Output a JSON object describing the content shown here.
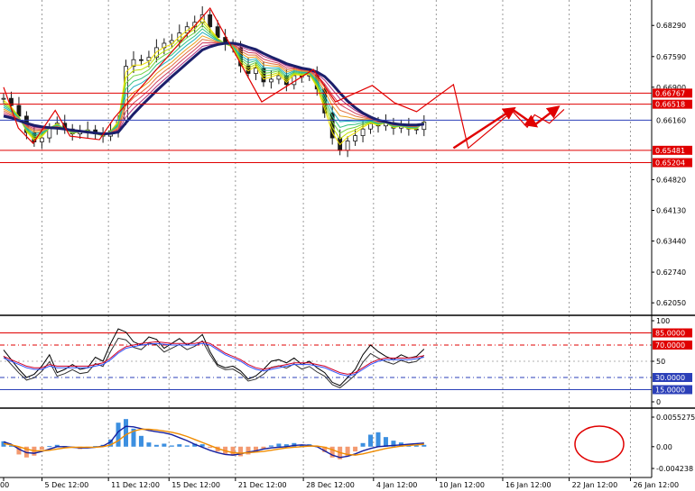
{
  "chart_data": {
    "type": "line",
    "main": {
      "type": "candlestick",
      "ylim": [
        0.6185,
        0.687
      ],
      "price_ticks": [
        "0.68290",
        "0.67590",
        "0.66900",
        "0.64820",
        "0.64130",
        "0.63440",
        "0.62740",
        "0.62050"
      ],
      "levels": [
        {
          "label": "0.66767",
          "value": 0.66767,
          "color": "#e00000"
        },
        {
          "label": "0.66518",
          "value": 0.66518,
          "color": "#e00000"
        },
        {
          "label": "0.66160",
          "value": 0.6616,
          "color": "#2b3fb8"
        },
        {
          "label": "0.65481",
          "value": 0.65481,
          "color": "#e00000"
        },
        {
          "label": "0.65204",
          "value": 0.65204,
          "color": "#e00000"
        }
      ],
      "close": [
        0.6665,
        0.6649,
        0.6625,
        0.6588,
        0.6567,
        0.6576,
        0.6598,
        0.6609,
        0.6596,
        0.6585,
        0.659,
        0.6594,
        0.6585,
        0.658,
        0.6592,
        0.6616,
        0.6737,
        0.6752,
        0.675,
        0.6757,
        0.6779,
        0.6789,
        0.6795,
        0.6812,
        0.6826,
        0.6836,
        0.6853,
        0.6826,
        0.6802,
        0.6787,
        0.6779,
        0.6738,
        0.6721,
        0.6733,
        0.6702,
        0.6708,
        0.6716,
        0.6696,
        0.6716,
        0.6715,
        0.6718,
        0.6686,
        0.6632,
        0.6576,
        0.6548,
        0.6569,
        0.6581,
        0.6596,
        0.6608,
        0.6603,
        0.661,
        0.6598,
        0.6602,
        0.6596,
        0.6595,
        0.6612
      ],
      "ma_slow": [
        0.6625,
        0.6621,
        0.6615,
        0.6609,
        0.6604,
        0.6601,
        0.6599,
        0.6598,
        0.6596,
        0.6593,
        0.6591,
        0.6589,
        0.6587,
        0.6585,
        0.6586,
        0.6589,
        0.661,
        0.663,
        0.6648,
        0.6665,
        0.6682,
        0.6698,
        0.6714,
        0.6729,
        0.6744,
        0.6759,
        0.6774,
        0.6781,
        0.6786,
        0.6789,
        0.6789,
        0.6786,
        0.678,
        0.6775,
        0.6766,
        0.6758,
        0.6751,
        0.6743,
        0.6738,
        0.6733,
        0.673,
        0.6724,
        0.6714,
        0.6697,
        0.6677,
        0.6659,
        0.6644,
        0.6632,
        0.6623,
        0.6616,
        0.6612,
        0.6608,
        0.6606,
        0.6605,
        0.6605,
        0.6607
      ],
      "zigzag": [
        [
          0,
          0.669
        ],
        [
          2,
          0.6598
        ],
        [
          4,
          0.6564
        ],
        [
          7,
          0.6638
        ],
        [
          9,
          0.658
        ],
        [
          13,
          0.6572
        ],
        [
          15,
          0.6621
        ],
        [
          28,
          0.6868
        ],
        [
          35,
          0.6657
        ],
        [
          42,
          0.673
        ],
        [
          45,
          0.6657
        ],
        [
          50,
          0.6694
        ],
        [
          53,
          0.6655
        ],
        [
          56,
          0.6635
        ],
        [
          61,
          0.6696
        ],
        [
          63,
          0.6553
        ],
        [
          69,
          0.6636
        ],
        [
          71,
          0.66
        ],
        [
          72,
          0.6628
        ],
        [
          74,
          0.6609
        ],
        [
          76,
          0.664
        ]
      ],
      "arrows": [
        [
          [
            61,
            0.6553
          ],
          [
            69,
            0.664
          ]
        ],
        [
          [
            69,
            0.664
          ],
          [
            72,
            0.6605
          ]
        ],
        [
          [
            72,
            0.6605
          ],
          [
            75,
            0.6643
          ]
        ]
      ]
    },
    "oscillator": {
      "ylim": [
        0,
        100
      ],
      "ticks": [
        "100",
        "50",
        "0"
      ],
      "levels": [
        {
          "label": "85.0000",
          "value": 85,
          "color": "#e00000"
        },
        {
          "label": "70.0000",
          "value": 70,
          "color": "#e00000"
        },
        {
          "label": "30.0000",
          "value": 30,
          "color": "#2b3fb8"
        },
        {
          "label": "15.0000",
          "value": 15,
          "color": "#2b3fb8"
        }
      ],
      "main": [
        64,
        52,
        40,
        30,
        34,
        44,
        58,
        36,
        40,
        46,
        40,
        42,
        55,
        50,
        72,
        90,
        86,
        74,
        70,
        80,
        77,
        66,
        72,
        78,
        70,
        75,
        83,
        62,
        46,
        42,
        44,
        38,
        28,
        32,
        40,
        50,
        52,
        48,
        54,
        46,
        50,
        42,
        36,
        24,
        20,
        30,
        40,
        58,
        70,
        62,
        56,
        52,
        58,
        54,
        56,
        65
      ],
      "signal": [
        56,
        52,
        48,
        44,
        42,
        42,
        46,
        44,
        44,
        44,
        44,
        44,
        46,
        48,
        54,
        62,
        68,
        70,
        72,
        73,
        74,
        73,
        72,
        72,
        72,
        72,
        74,
        72,
        66,
        60,
        56,
        52,
        46,
        42,
        40,
        42,
        44,
        46,
        48,
        48,
        48,
        46,
        44,
        40,
        36,
        34,
        36,
        42,
        48,
        52,
        54,
        54,
        54,
        54,
        55,
        57
      ]
    },
    "macd": {
      "ylim": [
        -0.004238,
        0.0055275
      ],
      "ticks": [
        "0.0055275",
        "0.00",
        "-0.004238"
      ],
      "histogram": [
        0.0009,
        0.0002,
        -0.0013,
        -0.0018,
        -0.0015,
        -0.0005,
        0.0001,
        0.0003,
        0.0001,
        -0.0002,
        -0.0004,
        -0.0002,
        0.0001,
        0.0003,
        0.0012,
        0.004,
        0.0046,
        0.003,
        0.0018,
        0.0007,
        0.0003,
        0.0005,
        0.0002,
        0.0004,
        0.0002,
        0.0005,
        0.0004,
        -0.0002,
        -0.0008,
        -0.0012,
        -0.0015,
        -0.0016,
        -0.0013,
        -0.0008,
        -0.0004,
        0.0002,
        0.0005,
        0.0004,
        0.0006,
        0.0003,
        0.0004,
        0.0001,
        -0.0009,
        -0.0018,
        -0.0021,
        -0.0016,
        -0.0008,
        0.0006,
        0.002,
        0.0024,
        0.0016,
        0.001,
        0.0007,
        0.0004,
        0.0002,
        0.0003
      ],
      "macd_line": [
        0.0008,
        0.0004,
        -0.0004,
        -0.001,
        -0.0011,
        -0.0008,
        -0.0004,
        0.0,
        0.0,
        -0.0001,
        -0.0002,
        -0.0002,
        -0.0001,
        0.0001,
        0.0008,
        0.0025,
        0.0034,
        0.0033,
        0.003,
        0.0027,
        0.0025,
        0.0023,
        0.002,
        0.0015,
        0.001,
        0.0004,
        -0.0001,
        -0.0006,
        -0.001,
        -0.0013,
        -0.0014,
        -0.0012,
        -0.0009,
        -0.0007,
        -0.0004,
        -0.0002,
        -0.0001,
        0.0,
        0.0002,
        0.0003,
        0.0002,
        0.0,
        -0.0007,
        -0.0014,
        -0.0018,
        -0.0016,
        -0.0012,
        -0.0007,
        -0.0003,
        0.0,
        0.0001,
        0.0002,
        0.0003,
        0.0004,
        0.0005,
        0.0006
      ],
      "signal_line": [
        0.0005,
        0.0003,
        0.0,
        -0.0004,
        -0.0007,
        -0.0007,
        -0.0006,
        -0.0004,
        -0.0002,
        -0.0001,
        -0.0001,
        -0.0001,
        -0.0001,
        0.0,
        0.0003,
        0.001,
        0.002,
        0.0026,
        0.0029,
        0.0029,
        0.0028,
        0.0026,
        0.0024,
        0.0021,
        0.0017,
        0.0012,
        0.0007,
        0.0002,
        -0.0003,
        -0.0007,
        -0.001,
        -0.0011,
        -0.001,
        -0.0009,
        -0.0008,
        -0.0006,
        -0.0004,
        -0.0002,
        -0.0001,
        0.0,
        0.0001,
        0.0001,
        -0.0001,
        -0.0005,
        -0.001,
        -0.0013,
        -0.0014,
        -0.0012,
        -0.0009,
        -0.0006,
        -0.0003,
        -0.0001,
        0.0001,
        0.0002,
        0.0003,
        0.0004
      ]
    },
    "x_labels": [
      "00",
      "5 Dec 12:00",
      "11 Dec 12:00",
      "15 Dec 12:00",
      "21 Dec 12:00",
      "28 Dec 12:00",
      "4 Jan 12:00",
      "10 Jan 12:00",
      "16 Jan 12:00",
      "22 Jan 12:00",
      "26 Jan 12:00"
    ],
    "x_label_index": [
      0,
      5.2,
      14.2,
      22.4,
      31.4,
      40.6,
      50.1,
      58.6,
      67.6,
      76.6,
      84.9
    ],
    "colors": {
      "bull": "#1a1a1a",
      "bear": "#1a1a1a",
      "ma_slow": "#1b1f6b",
      "zigzag": "#e00000",
      "arrow": "#e00000",
      "osc_main": "#000000",
      "osc_signal": "#d0002a",
      "osc_third": "#3050ff",
      "hist_pos": "#3c8fe0",
      "hist_neg": "#f39a70",
      "macd_line": "#1520a0",
      "signal_line": "#f08c00",
      "marker": "#e00000"
    }
  }
}
